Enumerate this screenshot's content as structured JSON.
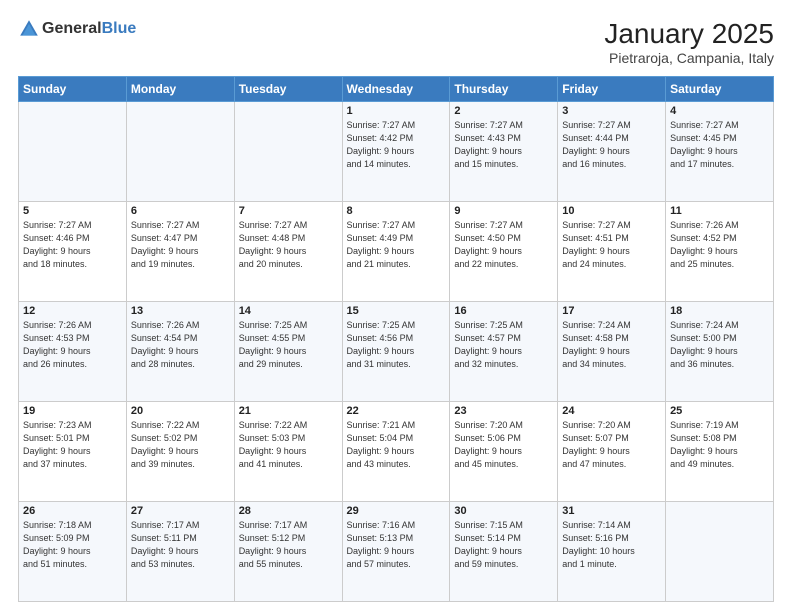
{
  "logo": {
    "general": "General",
    "blue": "Blue"
  },
  "title": "January 2025",
  "location": "Pietraroja, Campania, Italy",
  "weekdays": [
    "Sunday",
    "Monday",
    "Tuesday",
    "Wednesday",
    "Thursday",
    "Friday",
    "Saturday"
  ],
  "weeks": [
    [
      {
        "day": "",
        "info": ""
      },
      {
        "day": "",
        "info": ""
      },
      {
        "day": "",
        "info": ""
      },
      {
        "day": "1",
        "info": "Sunrise: 7:27 AM\nSunset: 4:42 PM\nDaylight: 9 hours\nand 14 minutes."
      },
      {
        "day": "2",
        "info": "Sunrise: 7:27 AM\nSunset: 4:43 PM\nDaylight: 9 hours\nand 15 minutes."
      },
      {
        "day": "3",
        "info": "Sunrise: 7:27 AM\nSunset: 4:44 PM\nDaylight: 9 hours\nand 16 minutes."
      },
      {
        "day": "4",
        "info": "Sunrise: 7:27 AM\nSunset: 4:45 PM\nDaylight: 9 hours\nand 17 minutes."
      }
    ],
    [
      {
        "day": "5",
        "info": "Sunrise: 7:27 AM\nSunset: 4:46 PM\nDaylight: 9 hours\nand 18 minutes."
      },
      {
        "day": "6",
        "info": "Sunrise: 7:27 AM\nSunset: 4:47 PM\nDaylight: 9 hours\nand 19 minutes."
      },
      {
        "day": "7",
        "info": "Sunrise: 7:27 AM\nSunset: 4:48 PM\nDaylight: 9 hours\nand 20 minutes."
      },
      {
        "day": "8",
        "info": "Sunrise: 7:27 AM\nSunset: 4:49 PM\nDaylight: 9 hours\nand 21 minutes."
      },
      {
        "day": "9",
        "info": "Sunrise: 7:27 AM\nSunset: 4:50 PM\nDaylight: 9 hours\nand 22 minutes."
      },
      {
        "day": "10",
        "info": "Sunrise: 7:27 AM\nSunset: 4:51 PM\nDaylight: 9 hours\nand 24 minutes."
      },
      {
        "day": "11",
        "info": "Sunrise: 7:26 AM\nSunset: 4:52 PM\nDaylight: 9 hours\nand 25 minutes."
      }
    ],
    [
      {
        "day": "12",
        "info": "Sunrise: 7:26 AM\nSunset: 4:53 PM\nDaylight: 9 hours\nand 26 minutes."
      },
      {
        "day": "13",
        "info": "Sunrise: 7:26 AM\nSunset: 4:54 PM\nDaylight: 9 hours\nand 28 minutes."
      },
      {
        "day": "14",
        "info": "Sunrise: 7:25 AM\nSunset: 4:55 PM\nDaylight: 9 hours\nand 29 minutes."
      },
      {
        "day": "15",
        "info": "Sunrise: 7:25 AM\nSunset: 4:56 PM\nDaylight: 9 hours\nand 31 minutes."
      },
      {
        "day": "16",
        "info": "Sunrise: 7:25 AM\nSunset: 4:57 PM\nDaylight: 9 hours\nand 32 minutes."
      },
      {
        "day": "17",
        "info": "Sunrise: 7:24 AM\nSunset: 4:58 PM\nDaylight: 9 hours\nand 34 minutes."
      },
      {
        "day": "18",
        "info": "Sunrise: 7:24 AM\nSunset: 5:00 PM\nDaylight: 9 hours\nand 36 minutes."
      }
    ],
    [
      {
        "day": "19",
        "info": "Sunrise: 7:23 AM\nSunset: 5:01 PM\nDaylight: 9 hours\nand 37 minutes."
      },
      {
        "day": "20",
        "info": "Sunrise: 7:22 AM\nSunset: 5:02 PM\nDaylight: 9 hours\nand 39 minutes."
      },
      {
        "day": "21",
        "info": "Sunrise: 7:22 AM\nSunset: 5:03 PM\nDaylight: 9 hours\nand 41 minutes."
      },
      {
        "day": "22",
        "info": "Sunrise: 7:21 AM\nSunset: 5:04 PM\nDaylight: 9 hours\nand 43 minutes."
      },
      {
        "day": "23",
        "info": "Sunrise: 7:20 AM\nSunset: 5:06 PM\nDaylight: 9 hours\nand 45 minutes."
      },
      {
        "day": "24",
        "info": "Sunrise: 7:20 AM\nSunset: 5:07 PM\nDaylight: 9 hours\nand 47 minutes."
      },
      {
        "day": "25",
        "info": "Sunrise: 7:19 AM\nSunset: 5:08 PM\nDaylight: 9 hours\nand 49 minutes."
      }
    ],
    [
      {
        "day": "26",
        "info": "Sunrise: 7:18 AM\nSunset: 5:09 PM\nDaylight: 9 hours\nand 51 minutes."
      },
      {
        "day": "27",
        "info": "Sunrise: 7:17 AM\nSunset: 5:11 PM\nDaylight: 9 hours\nand 53 minutes."
      },
      {
        "day": "28",
        "info": "Sunrise: 7:17 AM\nSunset: 5:12 PM\nDaylight: 9 hours\nand 55 minutes."
      },
      {
        "day": "29",
        "info": "Sunrise: 7:16 AM\nSunset: 5:13 PM\nDaylight: 9 hours\nand 57 minutes."
      },
      {
        "day": "30",
        "info": "Sunrise: 7:15 AM\nSunset: 5:14 PM\nDaylight: 9 hours\nand 59 minutes."
      },
      {
        "day": "31",
        "info": "Sunrise: 7:14 AM\nSunset: 5:16 PM\nDaylight: 10 hours\nand 1 minute."
      },
      {
        "day": "",
        "info": ""
      }
    ]
  ]
}
